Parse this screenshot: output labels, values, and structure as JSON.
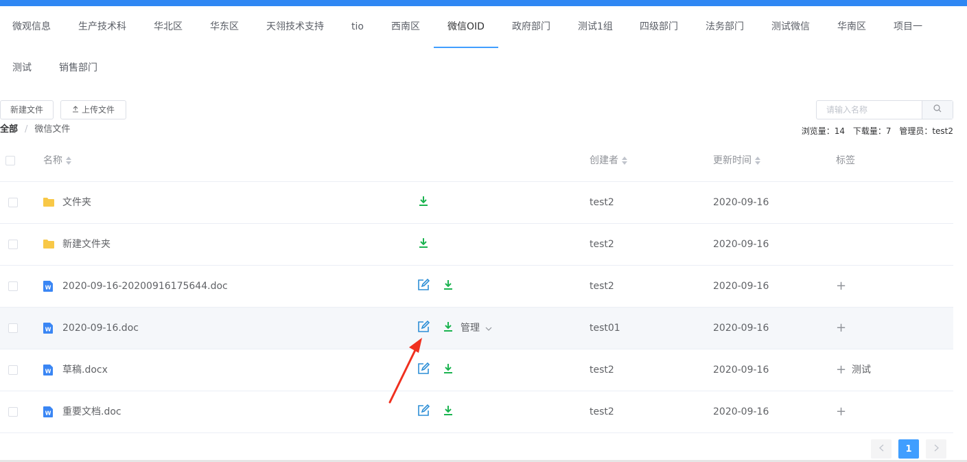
{
  "tabs": [
    {
      "label": "微观信息"
    },
    {
      "label": "生产技术科"
    },
    {
      "label": "华北区"
    },
    {
      "label": "华东区"
    },
    {
      "label": "天翎技术支持"
    },
    {
      "label": "tio"
    },
    {
      "label": "西南区"
    },
    {
      "label": "微信OID"
    },
    {
      "label": "政府部门"
    },
    {
      "label": "测试1组"
    },
    {
      "label": "四级部门"
    },
    {
      "label": "法务部门"
    },
    {
      "label": "测试微信"
    },
    {
      "label": "华南区"
    },
    {
      "label": "项目一"
    },
    {
      "label": "测试"
    },
    {
      "label": "销售部门"
    }
  ],
  "active_tab": "微信OID",
  "toolbar": {
    "new_file": "新建文件",
    "upload_file": "上传文件",
    "search_placeholder": "请输入名称"
  },
  "breadcrumb": {
    "root": "全部",
    "separator": "/",
    "current": "微信文件"
  },
  "stats": {
    "views": "浏览量：14",
    "downloads": "下载量：7",
    "admin": "管理员：test2"
  },
  "table": {
    "headers": {
      "name": "名称",
      "creator": "创建者",
      "updated": "更新时间",
      "tags": "标签"
    },
    "rows": [
      {
        "name": "文件夹",
        "type": "folder",
        "creator": "test2",
        "updated": "2020-09-16",
        "tag": ""
      },
      {
        "name": "新建文件夹",
        "type": "folder",
        "creator": "test2",
        "updated": "2020-09-16",
        "tag": ""
      },
      {
        "name": "2020-09-16-20200916175644.doc",
        "type": "doc",
        "creator": "test2",
        "updated": "2020-09-16",
        "tag": ""
      },
      {
        "name": "2020-09-16.doc",
        "type": "doc",
        "creator": "test01",
        "updated": "2020-09-16",
        "tag": "",
        "manage": "管理"
      },
      {
        "name": "草稿.docx",
        "type": "doc",
        "creator": "test2",
        "updated": "2020-09-16",
        "tag": "测试"
      },
      {
        "name": "重要文档.doc",
        "type": "doc",
        "creator": "test2",
        "updated": "2020-09-16",
        "tag": ""
      }
    ]
  },
  "pagination": {
    "current": "1"
  },
  "colors": {
    "accent": "#409eff",
    "download": "#1ab34f",
    "edit": "#2c8ed6",
    "folder": "#f8c847",
    "doc": "#3a86f4",
    "annotation_arrow": "#f0301f"
  },
  "icons": {
    "upload": "upload-icon",
    "search": "search-icon",
    "folder": "folder-icon",
    "doc": "word-doc-icon",
    "edit": "edit-icon",
    "download": "download-icon",
    "chevron": "chevron-down-icon",
    "plus": "plus-icon"
  }
}
